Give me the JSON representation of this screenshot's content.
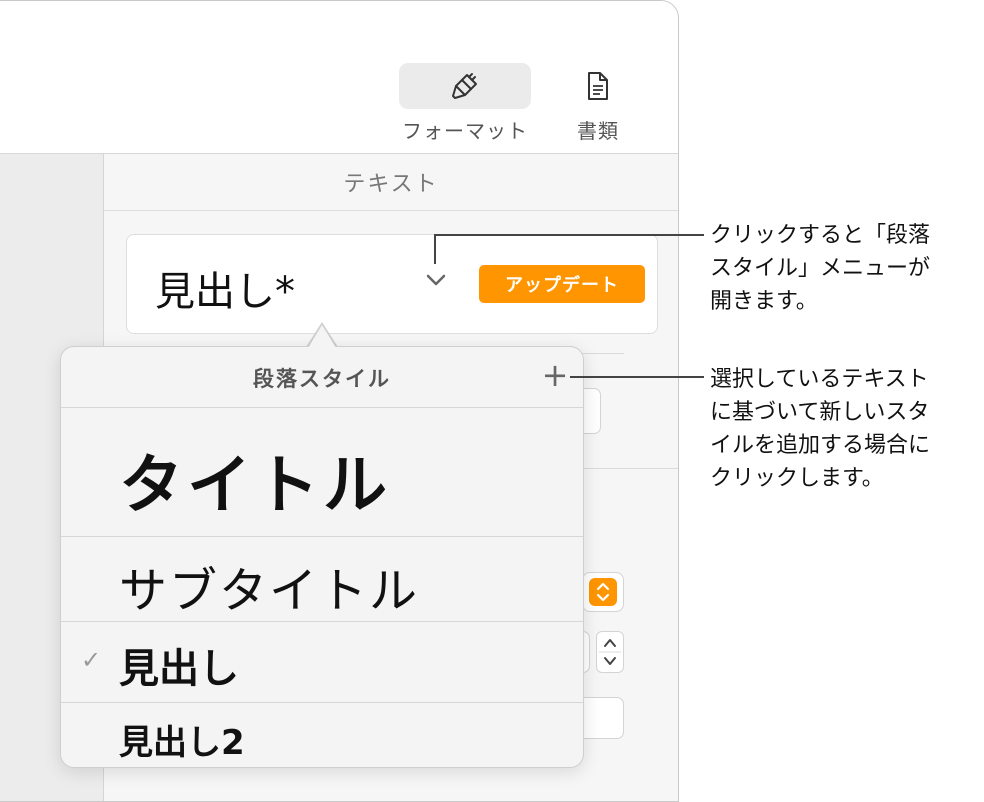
{
  "toolbar": {
    "format": {
      "label": "フォーマット",
      "icon": "paintbrush-icon"
    },
    "document": {
      "label": "書類",
      "icon": "document-icon"
    }
  },
  "inspector": {
    "tab_label": "テキスト",
    "paragraph_style": {
      "current": "見出し*",
      "update_label": "アップデート"
    }
  },
  "popup": {
    "title": "段落スタイル",
    "add_icon": "plus-icon",
    "items": [
      {
        "label": "タイトル",
        "checked": false
      },
      {
        "label": "サブタイトル",
        "checked": false
      },
      {
        "label": "見出し",
        "checked": true
      },
      {
        "label": "見出し2",
        "checked": false
      }
    ]
  },
  "callouts": {
    "style_menu": [
      "クリックすると「段落",
      "スタイル」メニューが",
      "開きます。"
    ],
    "add_style": [
      "選択しているテキスト",
      "に基づいて新しいスタ",
      "イルを追加する場合に",
      "クリックします。"
    ]
  },
  "colors": {
    "accent": "#ff9500",
    "checkmark": "#9a9a9a"
  }
}
